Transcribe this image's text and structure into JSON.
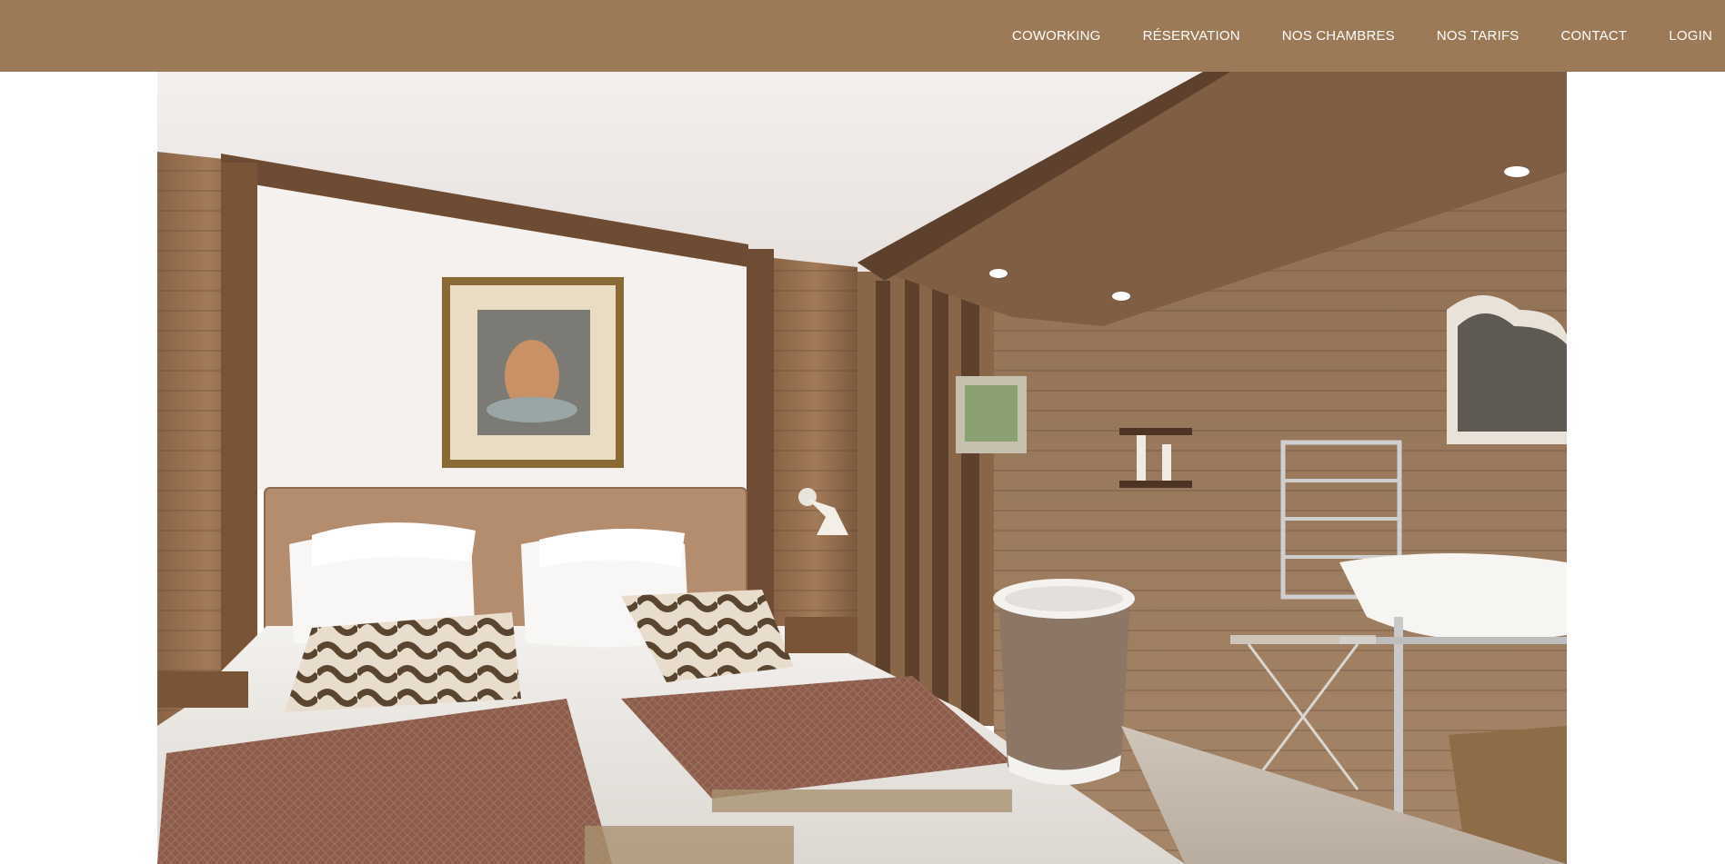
{
  "nav": {
    "items": [
      {
        "label": "COWORKING"
      },
      {
        "label": "RÉSERVATION"
      },
      {
        "label": "NOS CHAMBRES"
      },
      {
        "label": "NOS TARIFS"
      },
      {
        "label": "CONTACT"
      },
      {
        "label": "LOGIN"
      }
    ]
  },
  "colors": {
    "nav_background": "#9c7a58",
    "nav_text": "#ffffff",
    "page_background": "#ffffff"
  },
  "hero": {
    "image_subject": "chalet-bedroom-photo"
  }
}
